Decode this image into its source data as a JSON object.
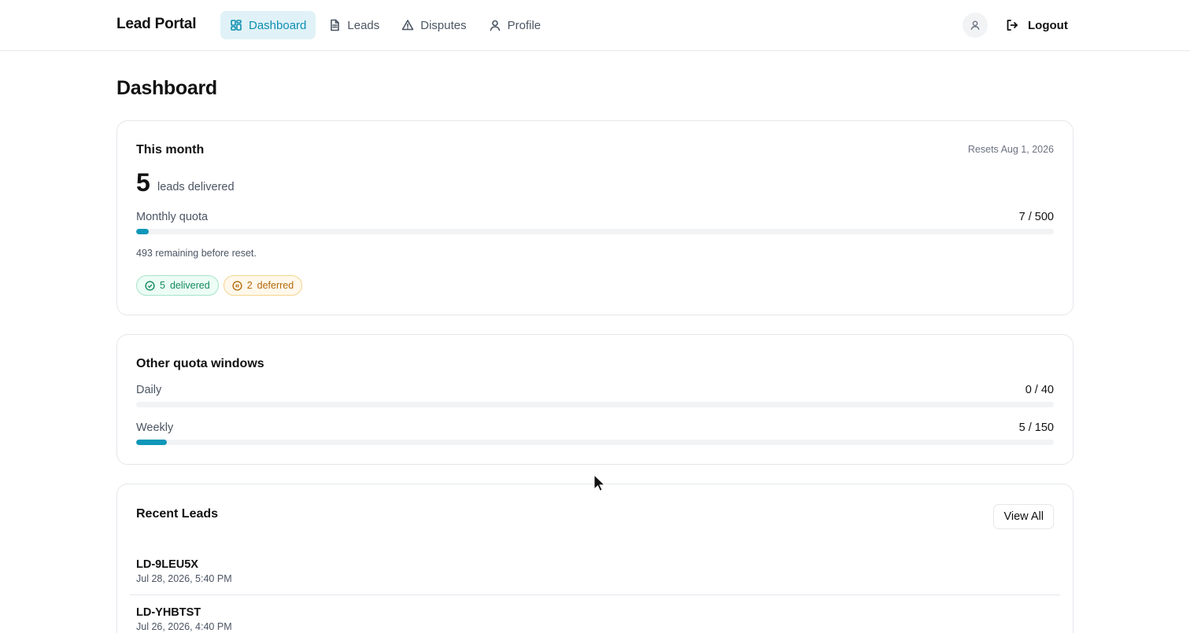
{
  "header": {
    "brand": "Lead Portal",
    "nav": [
      {
        "label": "Dashboard",
        "icon": "dashboard-icon",
        "active": true
      },
      {
        "label": "Leads",
        "icon": "document-icon",
        "active": false
      },
      {
        "label": "Disputes",
        "icon": "warning-triangle-icon",
        "active": false
      },
      {
        "label": "Profile",
        "icon": "user-icon",
        "active": false
      }
    ],
    "logout_label": "Logout"
  },
  "page": {
    "title": "Dashboard"
  },
  "this_month": {
    "title": "This month",
    "resets": "Resets Aug 1, 2026",
    "leads_count": "5",
    "leads_label": "leads delivered",
    "quota_label": "Monthly quota",
    "quota_value": "7 / 500",
    "quota_fraction": 0.014,
    "remaining_text": "493 remaining before reset.",
    "badges": [
      {
        "count": "5",
        "label": "delivered",
        "icon": "check-circle-icon",
        "color": "#128a5b"
      },
      {
        "count": "2",
        "label": "deferred",
        "icon": "pause-circle-icon",
        "color": "#b46a0b"
      }
    ]
  },
  "other_windows": {
    "title": "Other quota windows",
    "rows": [
      {
        "label": "Daily",
        "value": "0 / 40",
        "fraction": 0.0
      },
      {
        "label": "Weekly",
        "value": "5 / 150",
        "fraction": 0.0333
      }
    ]
  },
  "recent_leads": {
    "title": "Recent Leads",
    "view_all_label": "View All",
    "items": [
      {
        "id": "LD-9LEU5X",
        "date": "Jul 28, 2026, 5:40 PM"
      },
      {
        "id": "LD-YHBTST",
        "date": "Jul 26, 2026, 4:40 PM"
      }
    ]
  },
  "colors": {
    "accent": "#0e97b8",
    "active_nav_bg": "#e0f2f7",
    "border": "#e5e7eb"
  }
}
